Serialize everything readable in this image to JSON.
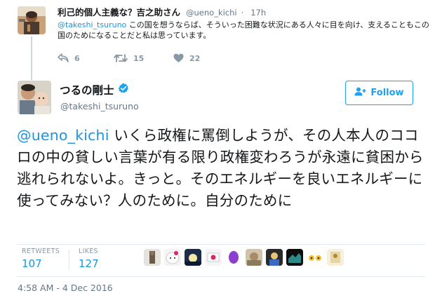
{
  "parent_tweet": {
    "display_name": "利己的個人主義な？吉之助さん",
    "handle": "@ueno_kichi",
    "separator": "·",
    "time": "17h",
    "mention": "@takeshi_tsuruno",
    "text": " この国を想うならば、そういった困難な状況にある人々に目を向け、支えることもこの国のためになることだと私は思っています。",
    "reply_count": "6",
    "retweet_count": "15",
    "like_count": "22"
  },
  "main_tweet": {
    "display_name": "つるの剛士",
    "handle": "@takeshi_tsuruno",
    "follow_label": "Follow",
    "mention": "@ueno_kichi",
    "text": " いくら政権に罵倒しようが、その人本人のココロの中の貧しい言葉が有る限り政権変わろうが永遠に貧困から逃れられないよ。きっと。そのエネルギーを良いエネルギーに使ってみない？人のために。自分のために",
    "retweets_label": "RETWEETS",
    "retweets_value": "107",
    "likes_label": "LIKES",
    "likes_value": "127",
    "timestamp": "4:58 AM - 4 Dec 2016"
  },
  "colors": {
    "link": "#1b95e0",
    "accent": "#1da1f2",
    "muted": "#657786",
    "icon": "#8899a6",
    "border": "#e1e8ed"
  },
  "icons": [
    "reply-icon",
    "retweet-icon",
    "heart-icon",
    "verified-badge-icon",
    "follow-person-icon"
  ]
}
